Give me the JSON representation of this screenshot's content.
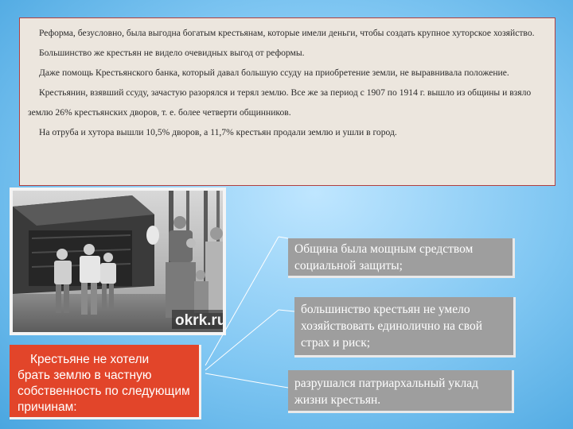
{
  "text_block": {
    "paragraphs": [
      "Реформа, безусловно, была выгодна богатым крестьянам, которые имели деньги, чтобы создать крупное хуторское хозяйство.",
      "Большинство же крестьян не видело очевидных выгод от реформы.",
      "Даже помощь Крестьянского банка, который давал большую ссуду на приобретение земли, не выравнивала положение.",
      "Крестьянин, взявший ссуду, зачастую разорялся и терял землю. Все же за период с 1907 по 1914 г. вышло из общины и взяло землю 26% крестьянских дворов, т. е. более четверти общинников.",
      "На отруба и хутора вышли 10,5% дворов, а 11,7% крестьян продали землю и ушли в город."
    ]
  },
  "photo": {
    "watermark": "okrk.ru"
  },
  "reasons_box": {
    "line1": "Крестьяне не хотели",
    "line2": "брать землю в частную собственность по следующим причинам:"
  },
  "reasons": [
    "Община была мощным средством социальной защиты;",
    "большинство крестьян не умело хозяйствовать единолично на свой страх и риск;",
    "разрушался патриархальный уклад жизни крестьян."
  ],
  "colors": {
    "accent_red": "#e2452a",
    "item_gray": "#9e9e9e",
    "text_border": "#b04040"
  }
}
